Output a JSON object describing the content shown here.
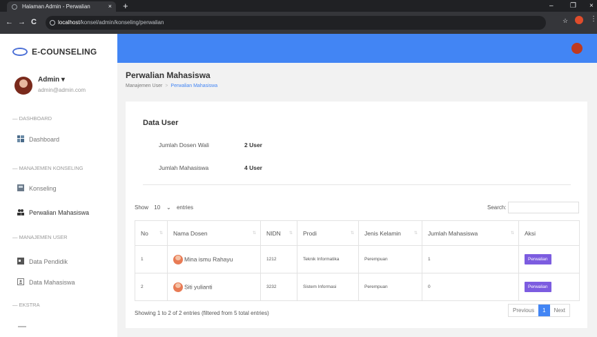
{
  "browser": {
    "tab_title": "Halaman Admin - Perwalian",
    "tab_close": "×",
    "new_tab": "+",
    "minimize": "–",
    "maximize": "❐",
    "close": "×",
    "back": "←",
    "forward": "→",
    "reload": "C",
    "url_host": "localhost",
    "url_path": "/konsel/admin/konseling/perwalian",
    "bookmark": "☆",
    "menu": "⋮"
  },
  "brand": {
    "name": "E-COUNSELING"
  },
  "user": {
    "name": "Admin ▾",
    "email": "admin@admin.com"
  },
  "sidebar": {
    "sections": [
      "— DASHBOARD",
      "— MANAJEMEN KONSELING",
      "— MANAJEMEN USER",
      "— EKSTRA"
    ],
    "items": [
      {
        "label": "Dashboard",
        "icon": "dashboard-icon"
      },
      {
        "label": "Konseling",
        "icon": "konseling-icon"
      },
      {
        "label": "Perwalian Mahasiswa",
        "icon": "users-icon"
      },
      {
        "label": "Data Pendidik",
        "icon": "id-card-icon"
      },
      {
        "label": "Data Mahasiswa",
        "icon": "student-icon"
      }
    ]
  },
  "header": {
    "title": "Perwalian Mahasiswa",
    "breadcrumb": [
      "Manajemen User",
      "Perwalian Mahasiswa"
    ],
    "breadcrumb_sep": ">"
  },
  "summary": {
    "title": "Data User",
    "rows": [
      {
        "label": "Jumlah Dosen Wali",
        "value": "2 User"
      },
      {
        "label": "Jumlah Mahasiswa",
        "value": "4 User"
      }
    ]
  },
  "table": {
    "show_label": "Show",
    "entries_value": "10",
    "entries_label": "entries",
    "search_label": "Search:",
    "columns": [
      "No",
      "Nama Dosen",
      "NIDN",
      "Prodi",
      "Jenis Kelamin",
      "Jumlah Mahasiswa",
      "Aksi"
    ],
    "rows": [
      {
        "no": "1",
        "nama": "Mina ismu Rahayu",
        "nidn": "1212",
        "prodi": "Teknik Informatika",
        "jk": "Perempuan",
        "jumlah": "1",
        "aksi": "Perwalian"
      },
      {
        "no": "2",
        "nama": "Siti yulianti",
        "nidn": "3232",
        "prodi": "Sistem Informasi",
        "jk": "Perempuan",
        "jumlah": "0",
        "aksi": "Perwalian"
      }
    ],
    "info": "Showing 1 to 2 of 2 entries (filtered from 5 total entries)",
    "pagination": {
      "previous": "Previous",
      "current": "1",
      "next": "Next"
    }
  },
  "colors": {
    "primary": "#4285f4",
    "action": "#7c5ce0"
  }
}
